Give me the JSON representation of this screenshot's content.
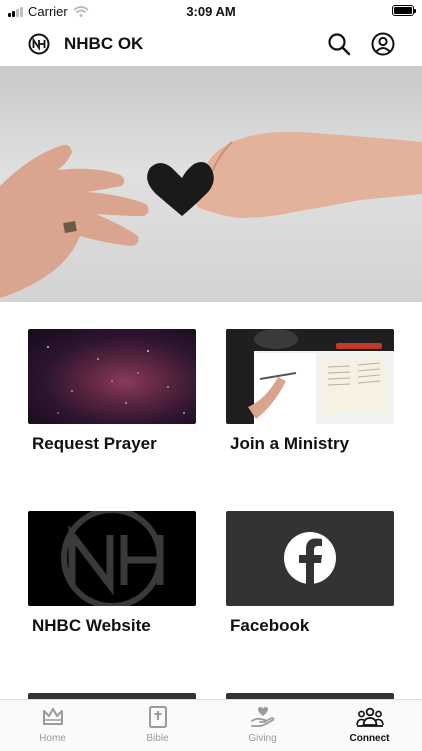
{
  "status_bar": {
    "carrier": "Carrier",
    "time": "3:09 AM"
  },
  "navbar": {
    "title": "NHBC OK"
  },
  "tiles": [
    {
      "label": "Request Prayer"
    },
    {
      "label": "Join a Ministry"
    },
    {
      "label": "NHBC Website"
    },
    {
      "label": "Facebook"
    }
  ],
  "tabbar": {
    "items": [
      {
        "label": "Home",
        "icon": "crown-icon"
      },
      {
        "label": "Bible",
        "icon": "bible-icon"
      },
      {
        "label": "Giving",
        "icon": "giving-hand-icon"
      },
      {
        "label": "Connect",
        "icon": "people-icon"
      }
    ],
    "active": "Connect"
  },
  "colors": {
    "accent": "#111111",
    "inactive": "#9a9a9a",
    "tile_dark": "#333333"
  }
}
